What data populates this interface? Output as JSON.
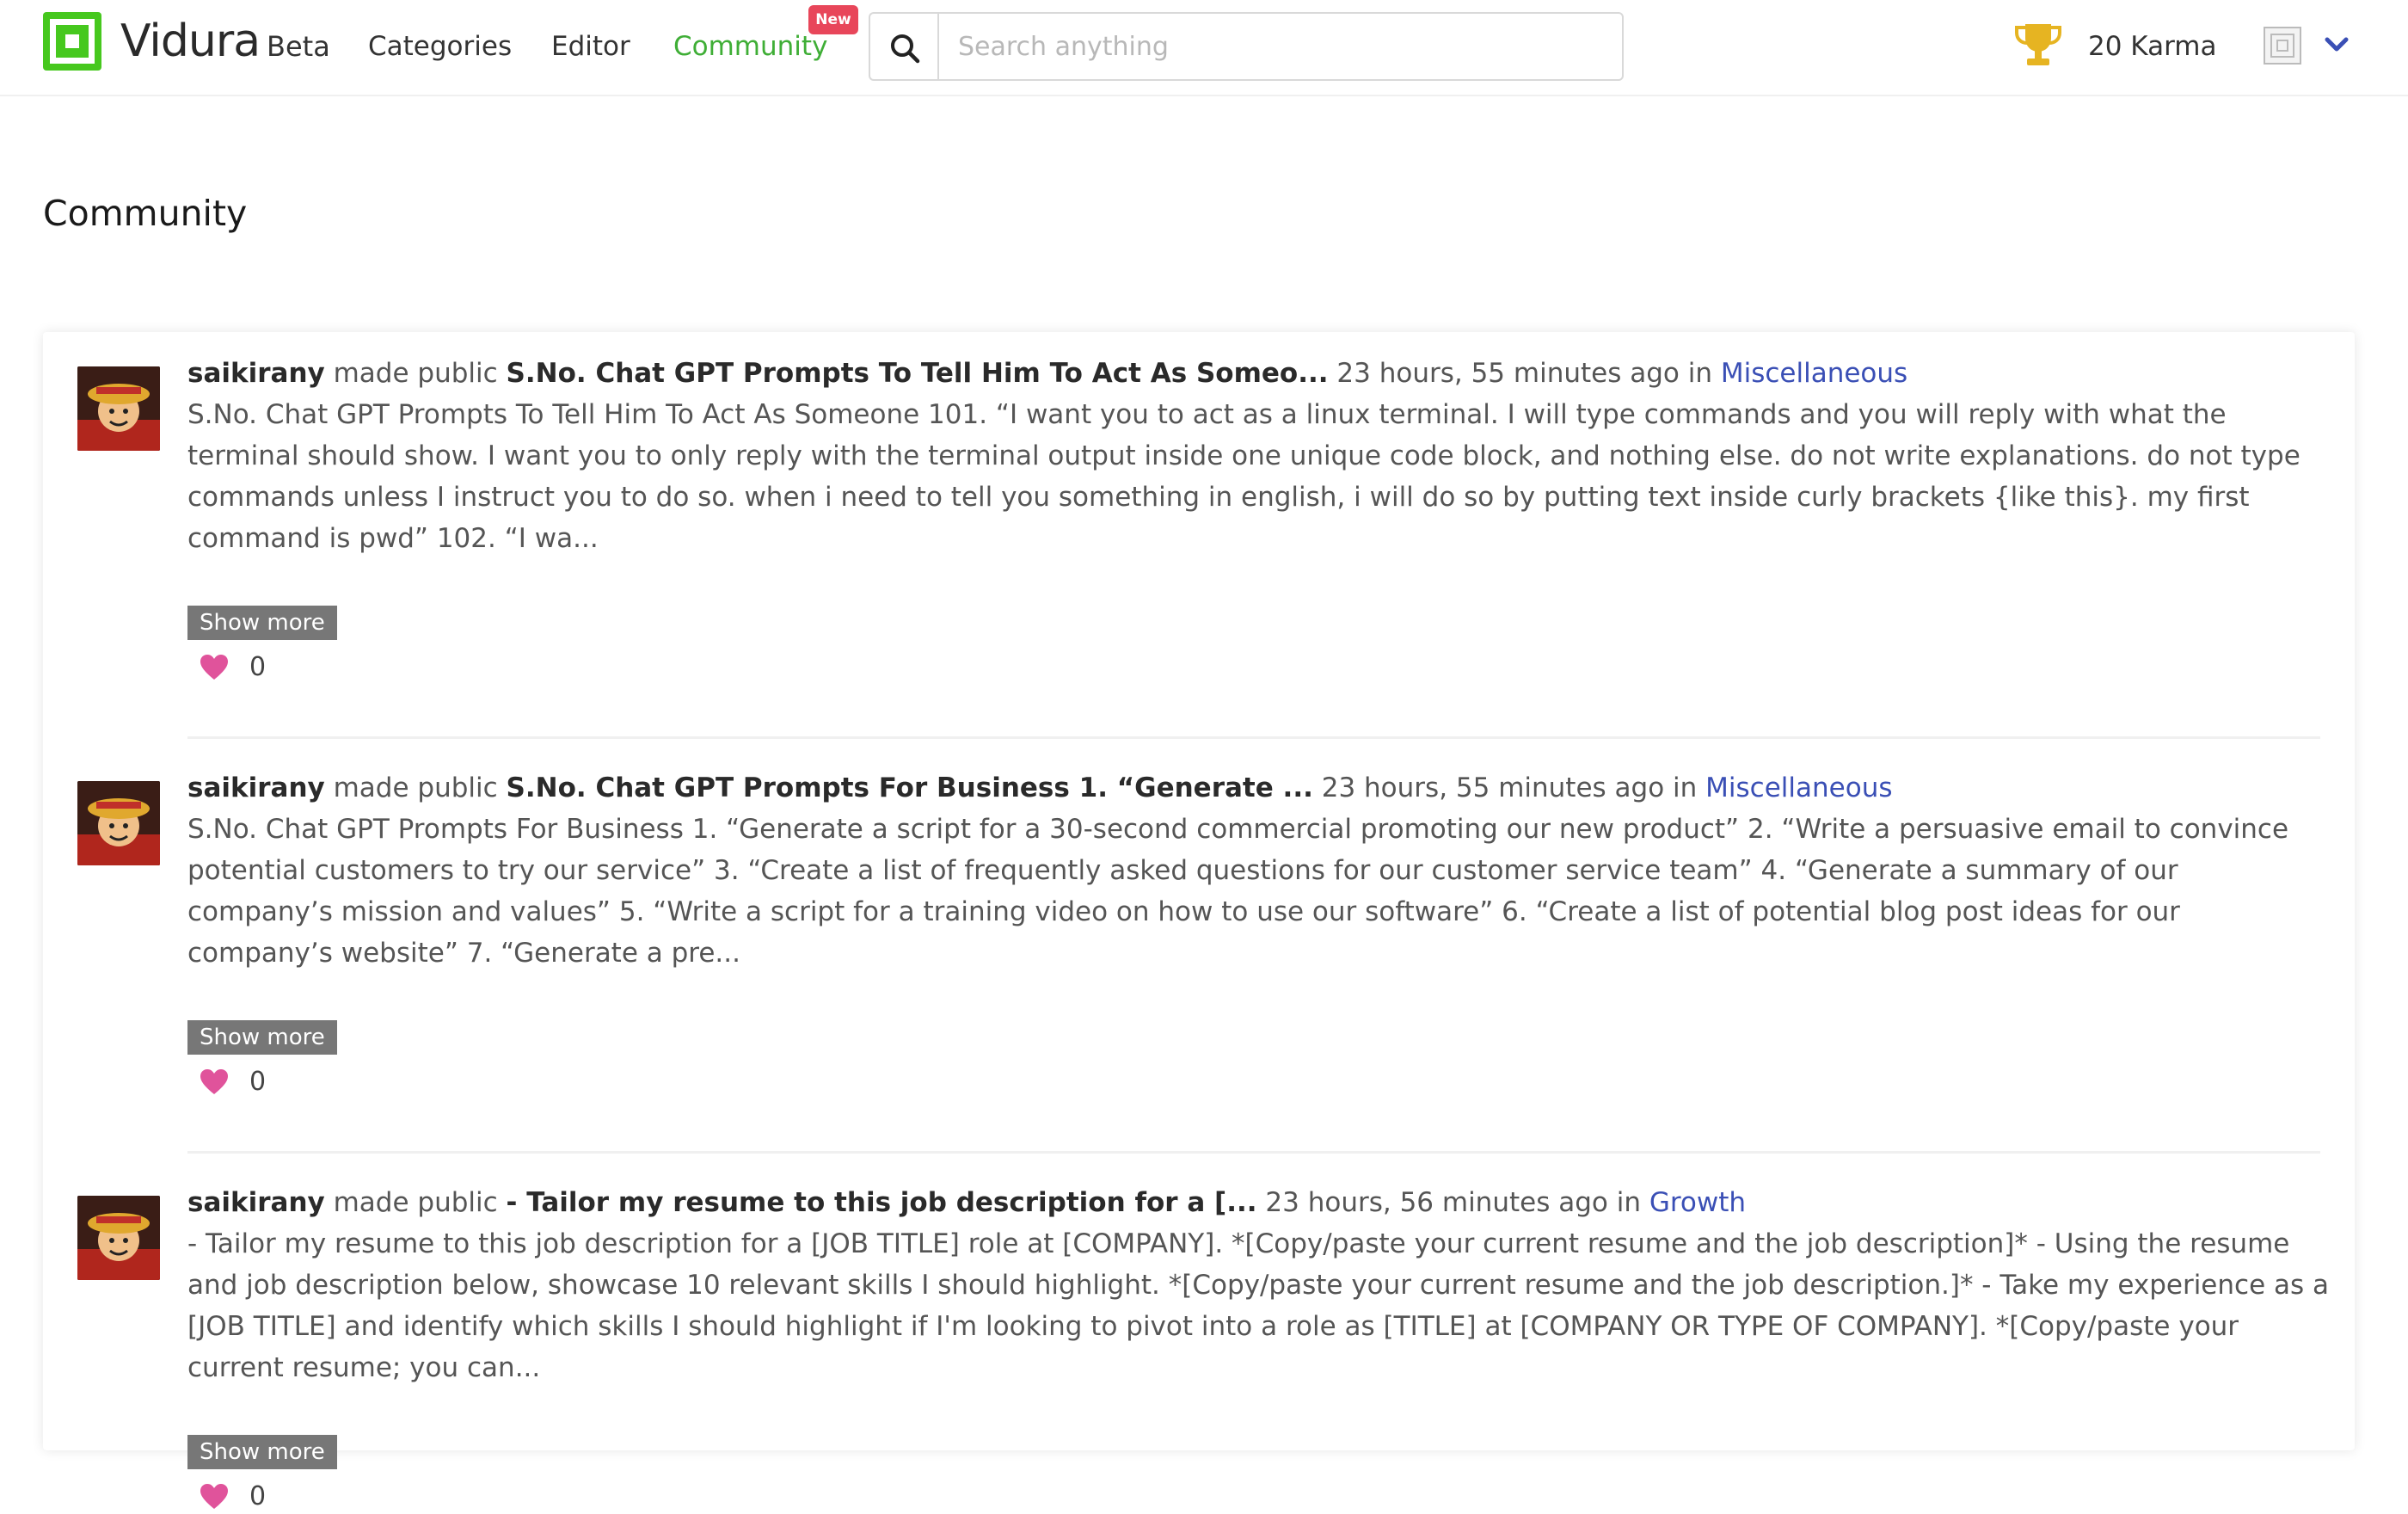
{
  "nav": {
    "brand": "Vidura",
    "beta": "Beta",
    "categories": "Categories",
    "editor": "Editor",
    "community": "Community",
    "new_badge": "New",
    "search_placeholder": "Search anything",
    "karma": "20 Karma",
    "icons": [
      "vidura-logo-icon",
      "search-icon",
      "trophy-icon",
      "user-avatar-icon",
      "chevron-down-icon"
    ]
  },
  "page": {
    "title": "Community"
  },
  "posts": [
    {
      "user": "saikirany",
      "action": "made public",
      "title": "S.No. Chat GPT Prompts To Tell Him To Act As Someo...",
      "time": "23 hours, 55 minutes ago",
      "in": "in",
      "category": "Miscellaneous",
      "body": "S.No. Chat GPT Prompts To Tell Him To Act As Someone 101. “I want you to act as a linux terminal. I will type commands and you will reply with what the terminal should show. I want you to only reply with the terminal output inside one unique code block, and nothing else. do not write explanations. do not type commands unless I instruct you to do so. when i need to tell you something in english, i will do so by putting text inside curly brackets {like this}. my first command is pwd” 102. “I wa...",
      "show_more": "Show more",
      "likes": "0"
    },
    {
      "user": "saikirany",
      "action": "made public",
      "title": "S.No. Chat GPT Prompts For Business 1. “Generate ...",
      "time": "23 hours, 55 minutes ago",
      "in": "in",
      "category": "Miscellaneous",
      "body": "S.No. Chat GPT Prompts For Business 1. “Generate a script for a 30-second commercial promoting our new product” 2. “Write a persuasive email to convince potential customers to try our service” 3. “Create a list of frequently asked questions for our customer service team” 4. “Generate a summary of our company’s mission and values” 5. “Write a script for a training video on how to use our software” 6. “Create a list of potential blog post ideas for our company’s website” 7. “Generate a pre...",
      "show_more": "Show more",
      "likes": "0"
    },
    {
      "user": "saikirany",
      "action": "made public",
      "title": "- Tailor my resume to this job description for a [...",
      "time": "23 hours, 56 minutes ago",
      "in": "in",
      "category": "Growth",
      "body": "- Tailor my resume to this job description for a [JOB TITLE] role at [COMPANY]. *[Copy/paste your current resume and the job description]* - Using the resume and job description below, showcase 10 relevant skills I should highlight. *[Copy/paste your current resume and the job description.]* - Take my experience as a [JOB TITLE] and identify which skills I should highlight if I'm looking to pivot into a role as [TITLE] at [COMPANY OR TYPE OF COMPANY]. *[Copy/paste your current resume; you can...",
      "show_more": "Show more",
      "likes": "0"
    }
  ],
  "colors": {
    "brand_green": "#46c81e",
    "community_green": "#3fae36",
    "badge_red": "#e8465a",
    "category_blue": "#3a4fb5",
    "heart_pink": "#e0539b",
    "trophy_gold": "#e6b422"
  }
}
